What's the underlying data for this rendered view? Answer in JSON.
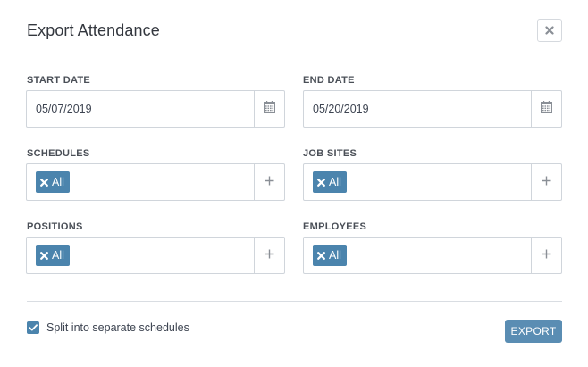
{
  "dialog": {
    "title": "Export Attendance",
    "close_icon": "close-icon"
  },
  "start_date": {
    "label": "START DATE",
    "value": "05/07/2019",
    "icon": "calendar-icon"
  },
  "end_date": {
    "label": "END DATE",
    "value": "05/20/2019",
    "icon": "calendar-icon"
  },
  "schedules": {
    "label": "SCHEDULES",
    "tag": "All",
    "icon": "plus-icon"
  },
  "job_sites": {
    "label": "JOB SITES",
    "tag": "All",
    "icon": "plus-icon"
  },
  "positions": {
    "label": "POSITIONS",
    "tag": "All",
    "icon": "plus-icon"
  },
  "employees": {
    "label": "EMPLOYEES",
    "tag": "All",
    "icon": "plus-icon"
  },
  "split_option": {
    "label": "Split into separate schedules",
    "checked": true
  },
  "export_button": {
    "label": "EXPORT"
  },
  "colors": {
    "accent": "#4b84ad",
    "button": "#5a8db3",
    "border": "#d0d5db"
  }
}
